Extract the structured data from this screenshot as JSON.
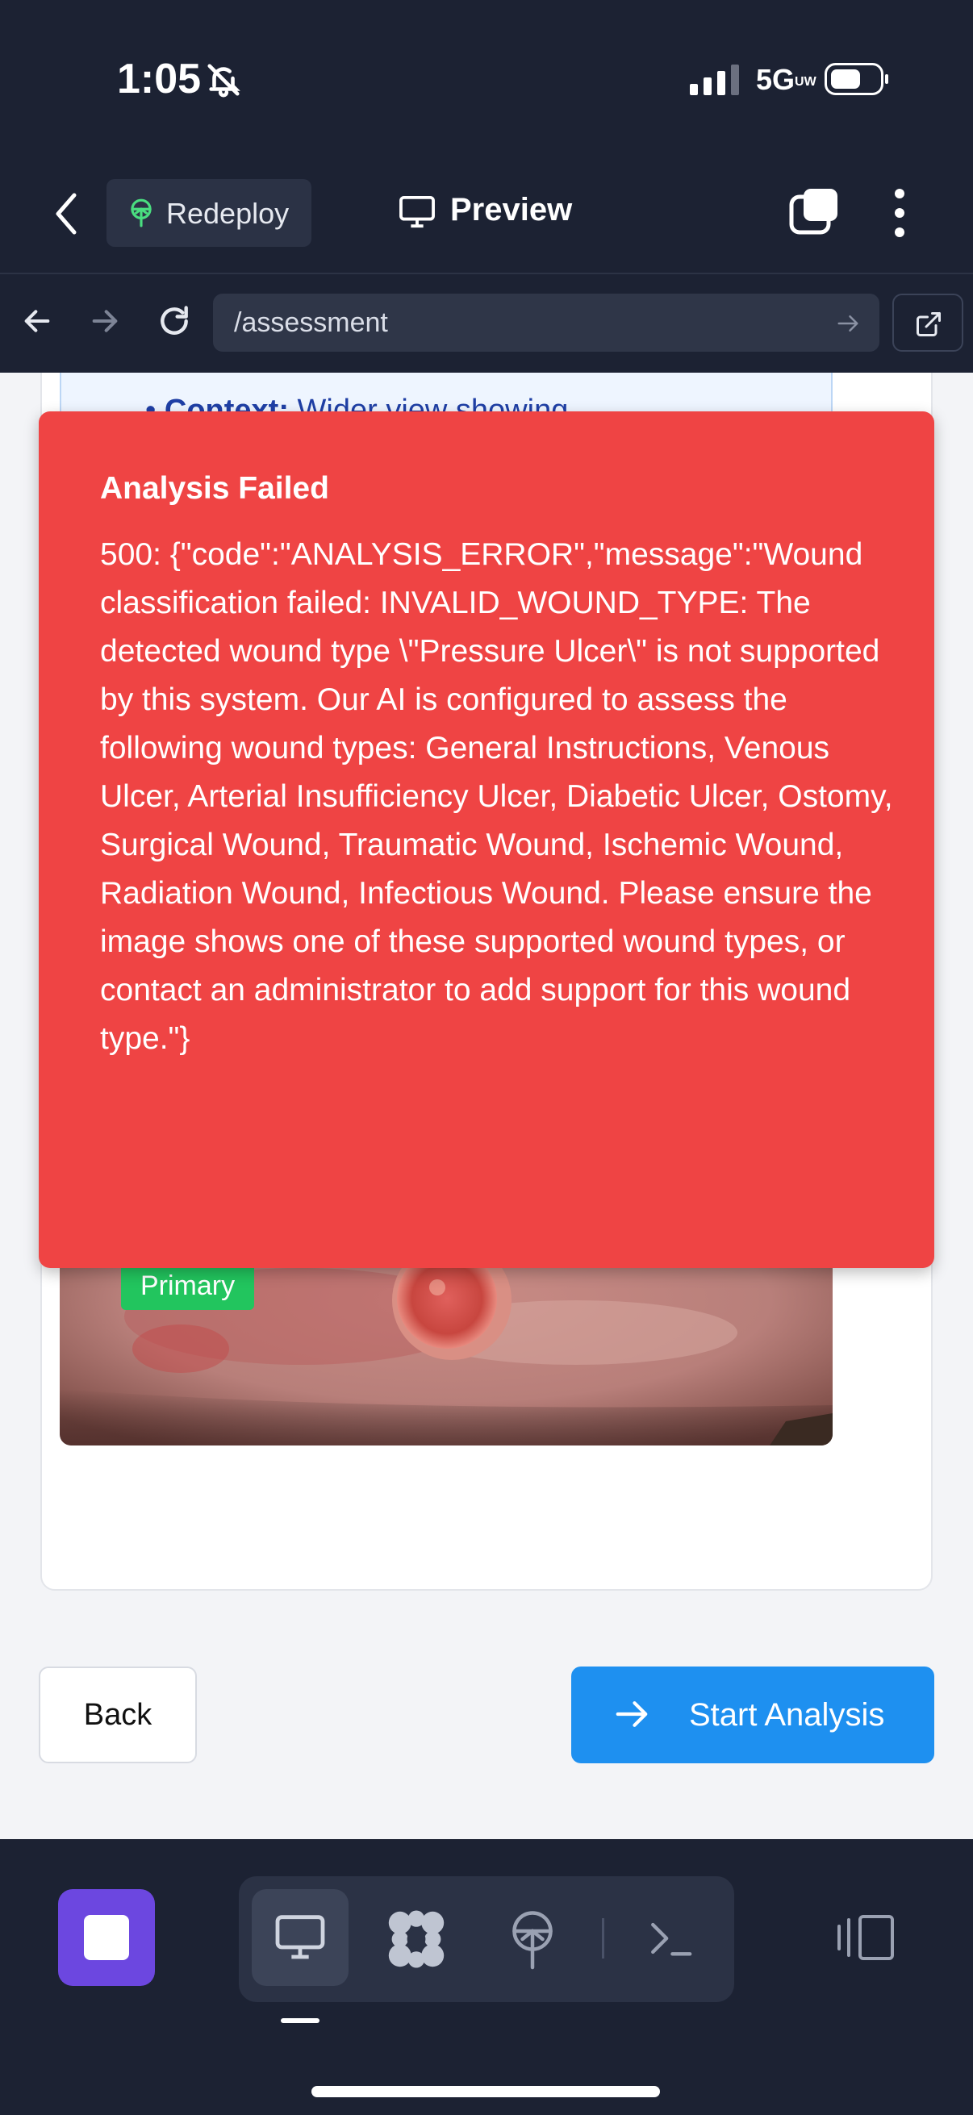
{
  "status_bar": {
    "time": "1:05",
    "network": "5G",
    "network_sub": "UW"
  },
  "app_header": {
    "redeploy_label": "Redeploy",
    "preview_label": "Preview"
  },
  "url_bar": {
    "url": "/assessment"
  },
  "page": {
    "tips_label": "Context:",
    "tips_text": "Wider view showing",
    "primary_badge": "Primary",
    "back_button": "Back",
    "start_button": "Start Analysis"
  },
  "error_toast": {
    "title": "Analysis Failed",
    "message": "500: {\"code\":\"ANALYSIS_ERROR\",\"message\":\"Wound classification failed: INVALID_WOUND_TYPE: The detected wound type \\\"Pressure Ulcer\\\" is not supported by this system. Our AI is configured to assess the following wound types: General Instructions, Venous Ulcer, Arterial Insufficiency Ulcer, Diabetic Ulcer, Ostomy, Surgical Wound, Traumatic Wound, Ischemic Wound, Radiation Wound, Infectious Wound. Please ensure the image shows one of these supported wound types, or contact an administrator to add support for this wound type.\"}"
  },
  "colors": {
    "error_bg": "#ef4444",
    "primary_button": "#1e90f0",
    "badge_green": "#22c55e",
    "stop_purple": "#6c47e0"
  },
  "icons": {
    "header": [
      "chevron-left-icon",
      "sprout-icon",
      "monitor-icon",
      "tabs-icon",
      "more-vertical-icon"
    ],
    "url_bar": [
      "arrow-left-icon",
      "arrow-right-icon",
      "reload-icon",
      "external-link-icon"
    ],
    "toolbar": [
      "stop-icon",
      "monitor-icon",
      "apps-grid-icon",
      "deploy-icon",
      "terminal-icon",
      "split-view-icon"
    ]
  }
}
